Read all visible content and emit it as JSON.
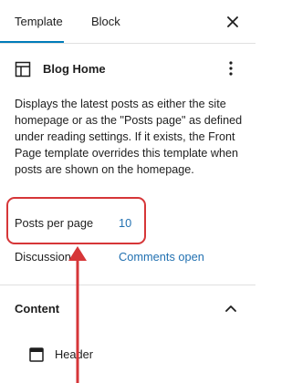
{
  "tabs": [
    {
      "label": "Template",
      "active": true
    },
    {
      "label": "Block",
      "active": false
    }
  ],
  "template": {
    "title": "Blog Home",
    "description": "Displays the latest posts as either the site homepage or as the \"Posts page\" as defined under reading settings. If it exists, the Front Page template overrides this template when posts are shown on the homepage."
  },
  "settings": {
    "posts_per_page_label": "Posts per page",
    "posts_per_page_value": "10",
    "discussion_label": "Discussion",
    "discussion_value": "Comments open"
  },
  "content": {
    "title": "Content",
    "items": [
      {
        "label": "Header",
        "icon": "template-part-icon"
      }
    ]
  },
  "colors": {
    "accent": "#007cba",
    "link": "#2271b1",
    "annotation": "#d63638"
  }
}
